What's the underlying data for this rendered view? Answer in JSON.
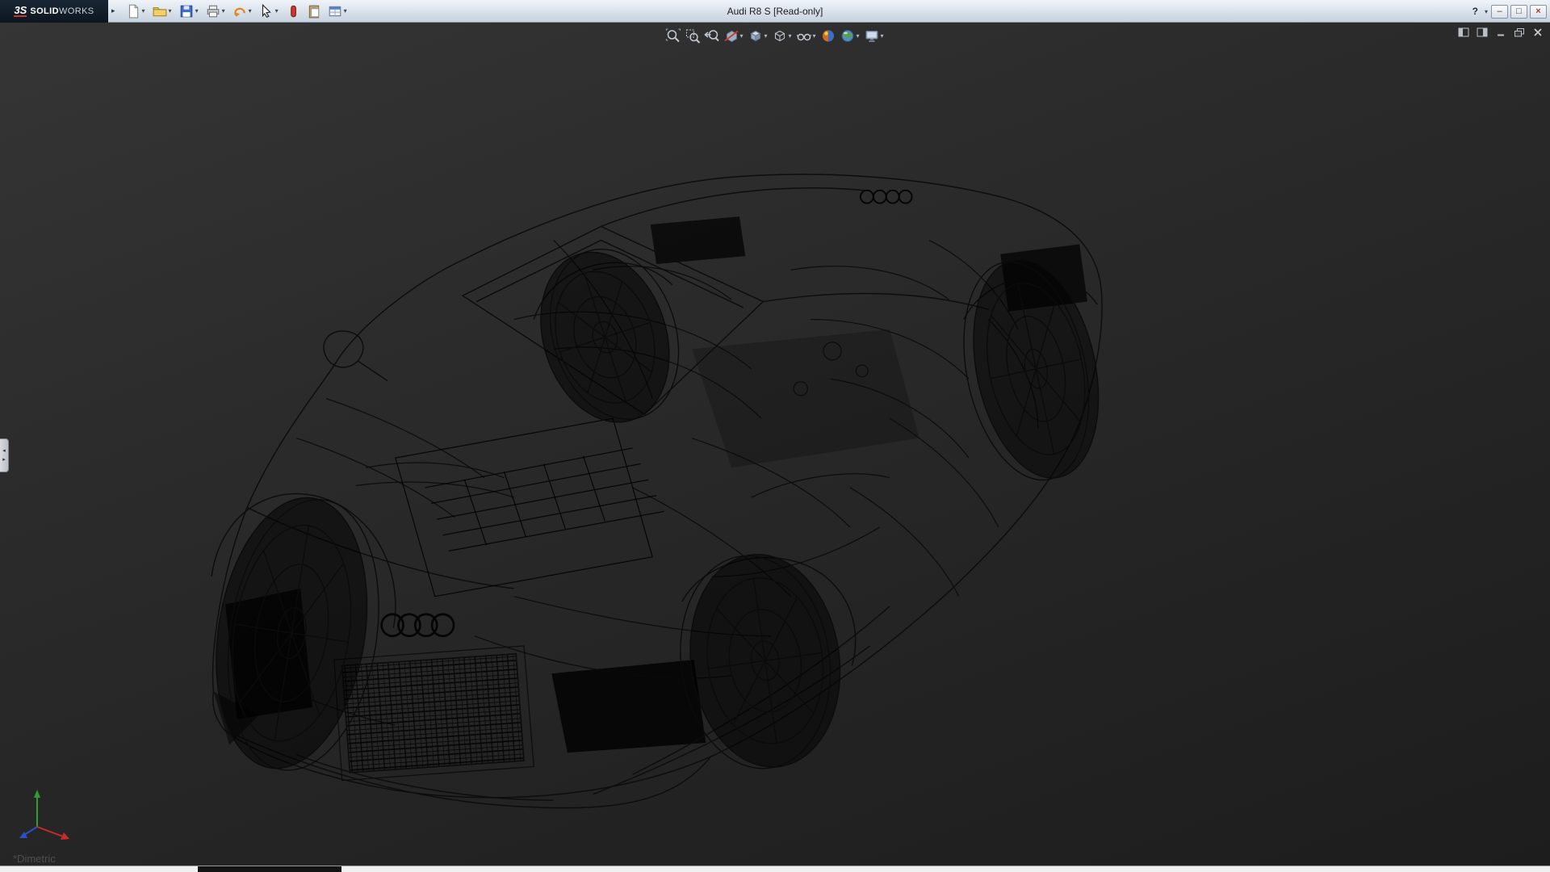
{
  "window": {
    "title": "Audi R8 S [Read-only]",
    "brand_glyph": "3S",
    "brand_bold": "SOLID",
    "brand_light": "WORKS",
    "toolbar_expand_glyph": "▸",
    "controls": {
      "help": "?",
      "minimize": "–",
      "maximize": "□",
      "close": "×"
    }
  },
  "file_toolbar": {
    "items": [
      {
        "icon": "new-document-icon",
        "dropdown": true
      },
      {
        "icon": "open-folder-icon",
        "dropdown": true
      },
      {
        "icon": "save-icon",
        "dropdown": true
      },
      {
        "icon": "print-icon",
        "dropdown": true
      },
      {
        "icon": "undo-icon",
        "dropdown": true
      },
      {
        "icon": "select-cursor-icon",
        "dropdown": true
      },
      {
        "icon": "xpress-products-icon",
        "dropdown": false
      },
      {
        "icon": "clipboard-icon",
        "dropdown": false
      },
      {
        "icon": "options-window-icon",
        "dropdown": true
      }
    ]
  },
  "heads_up_toolbar": {
    "items": [
      {
        "icon": "zoom-to-fit-icon",
        "dropdown": false
      },
      {
        "icon": "zoom-to-area-icon",
        "dropdown": false
      },
      {
        "icon": "previous-view-icon",
        "dropdown": false
      },
      {
        "icon": "section-view-icon",
        "dropdown": true
      },
      {
        "icon": "view-orientation-cube-icon",
        "dropdown": true
      },
      {
        "icon": "display-style-icon",
        "dropdown": true
      },
      {
        "icon": "hide-show-items-icon",
        "dropdown": true
      },
      {
        "icon": "edit-appearance-icon",
        "dropdown": false
      },
      {
        "icon": "apply-scene-icon",
        "dropdown": true
      },
      {
        "icon": "view-settings-icon",
        "dropdown": true
      }
    ]
  },
  "document_controls": {
    "items": [
      "split-pane-left-icon",
      "split-pane-right-icon",
      "minimize-document-icon",
      "restore-document-icon",
      "close-document-icon"
    ]
  },
  "left_tab": {
    "up": "◂",
    "down": "▸"
  },
  "viewport": {
    "view_orientation_label": "*Dimetric",
    "triad": {
      "x_color": "#cc2a2a",
      "y_color": "#2f9e2f",
      "z_color": "#2a50cc"
    }
  },
  "statusbar": {
    "segment_color": "#131313"
  }
}
